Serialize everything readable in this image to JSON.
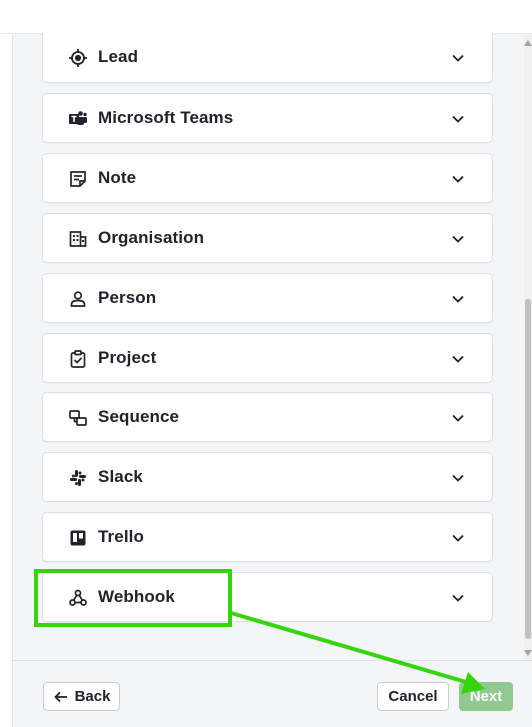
{
  "items": [
    {
      "label": "Lead",
      "icon": "target-icon"
    },
    {
      "label": "Microsoft Teams",
      "icon": "microsoft-teams-icon"
    },
    {
      "label": "Note",
      "icon": "note-icon"
    },
    {
      "label": "Organisation",
      "icon": "building-icon"
    },
    {
      "label": "Person",
      "icon": "person-icon"
    },
    {
      "label": "Project",
      "icon": "clipboard-check-icon"
    },
    {
      "label": "Sequence",
      "icon": "sequence-icon"
    },
    {
      "label": "Slack",
      "icon": "slack-icon"
    },
    {
      "label": "Trello",
      "icon": "trello-icon"
    },
    {
      "label": "Webhook",
      "icon": "webhook-icon"
    }
  ],
  "footer": {
    "back_label": "Back",
    "cancel_label": "Cancel",
    "next_label": "Next"
  },
  "colors": {
    "annotation": "#35d40f",
    "next_button": "#8fc98f",
    "text": "#21232c"
  }
}
